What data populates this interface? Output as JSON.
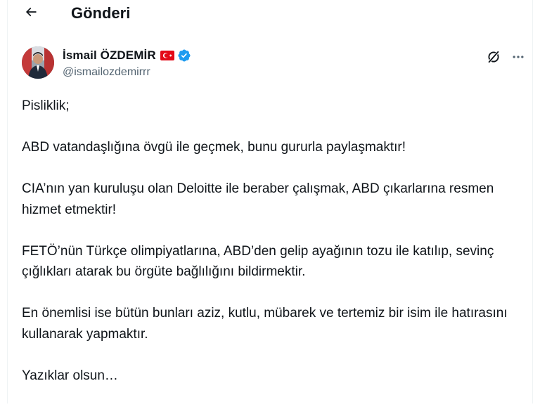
{
  "header": {
    "title": "Gönderi",
    "back_icon": "arrow-left-icon"
  },
  "author": {
    "display_name": "İsmail ÖZDEMİR",
    "handle": "@ismailozdemirrr",
    "flag_icon": "turkey-flag-icon",
    "verified_icon": "verified-badge-icon",
    "verified_color": "#1d9bf0"
  },
  "actions": {
    "grok_icon": "grok-icon",
    "more_icon": "more-horizontal-icon"
  },
  "post": {
    "paragraphs": [
      "Pisliklik;",
      "ABD vatandaşlığına övgü ile geçmek, bunu gururla paylaşmaktır!",
      "CIA’nın yan kuruluşu olan Deloitte ile beraber çalışmak, ABD çıkarlarına resmen hizmet etmektir!",
      "FETÖ’nün Türkçe olimpiyatlarına, ABD’den gelip ayağının tozu ile katılıp, sevinç çığlıkları atarak bu örgüte bağlılığını bildirmektir.",
      "En önemlisi ise bütün bunları aziz, kutlu, mübarek ve tertemiz bir isim ile hatırasını kullanarak yapmaktır.",
      "Yazıklar olsun…"
    ]
  },
  "colors": {
    "text": "#0f1419",
    "secondary_text": "#536471",
    "border": "#eff3f4",
    "flag_red": "#e30a17"
  }
}
